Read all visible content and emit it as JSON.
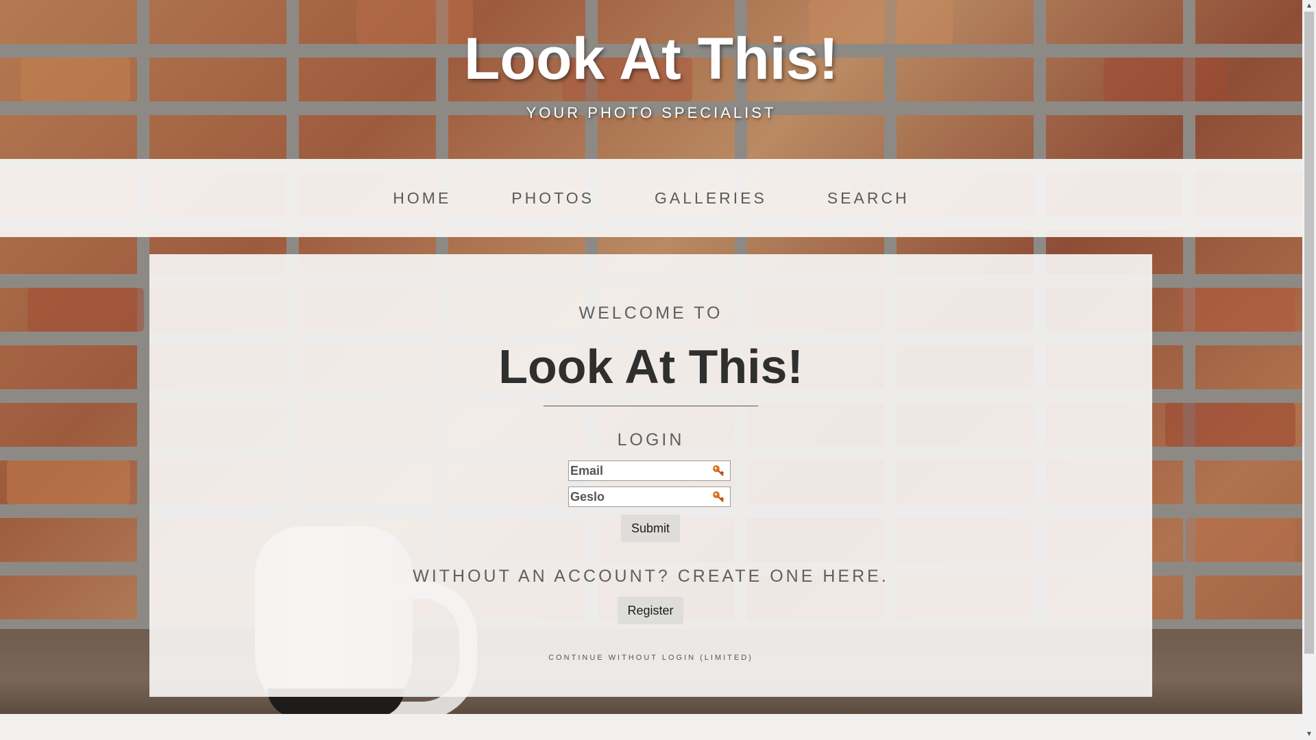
{
  "header": {
    "title": "Look At This!",
    "subtitle": "YOUR PHOTO SPECIALIST"
  },
  "nav": {
    "items": [
      {
        "label": "HOME"
      },
      {
        "label": "PHOTOS"
      },
      {
        "label": "GALLERIES"
      },
      {
        "label": "SEARCH"
      }
    ]
  },
  "main": {
    "welcome": "WELCOME TO",
    "title": "Look At This!",
    "login_heading": "LOGIN",
    "email": {
      "placeholder": "Email",
      "value": "",
      "icon": "key-icon"
    },
    "password": {
      "placeholder": "Geslo",
      "value": "",
      "icon": "key-icon"
    },
    "submit_label": "Submit",
    "no_account_text": "WITHOUT AN ACCOUNT? CREATE ONE HERE.",
    "register_label": "Register",
    "continue_text": "CONTINUE WITHOUT LOGIN (LIMITED)"
  },
  "scrollbar": {
    "up_arrow": "▲",
    "down_arrow": "▼",
    "position": 0
  },
  "colors": {
    "accent_key_icon": "#f07c1a",
    "text_grey": "#5f5f5f",
    "title_dark": "#2f2f2f"
  }
}
